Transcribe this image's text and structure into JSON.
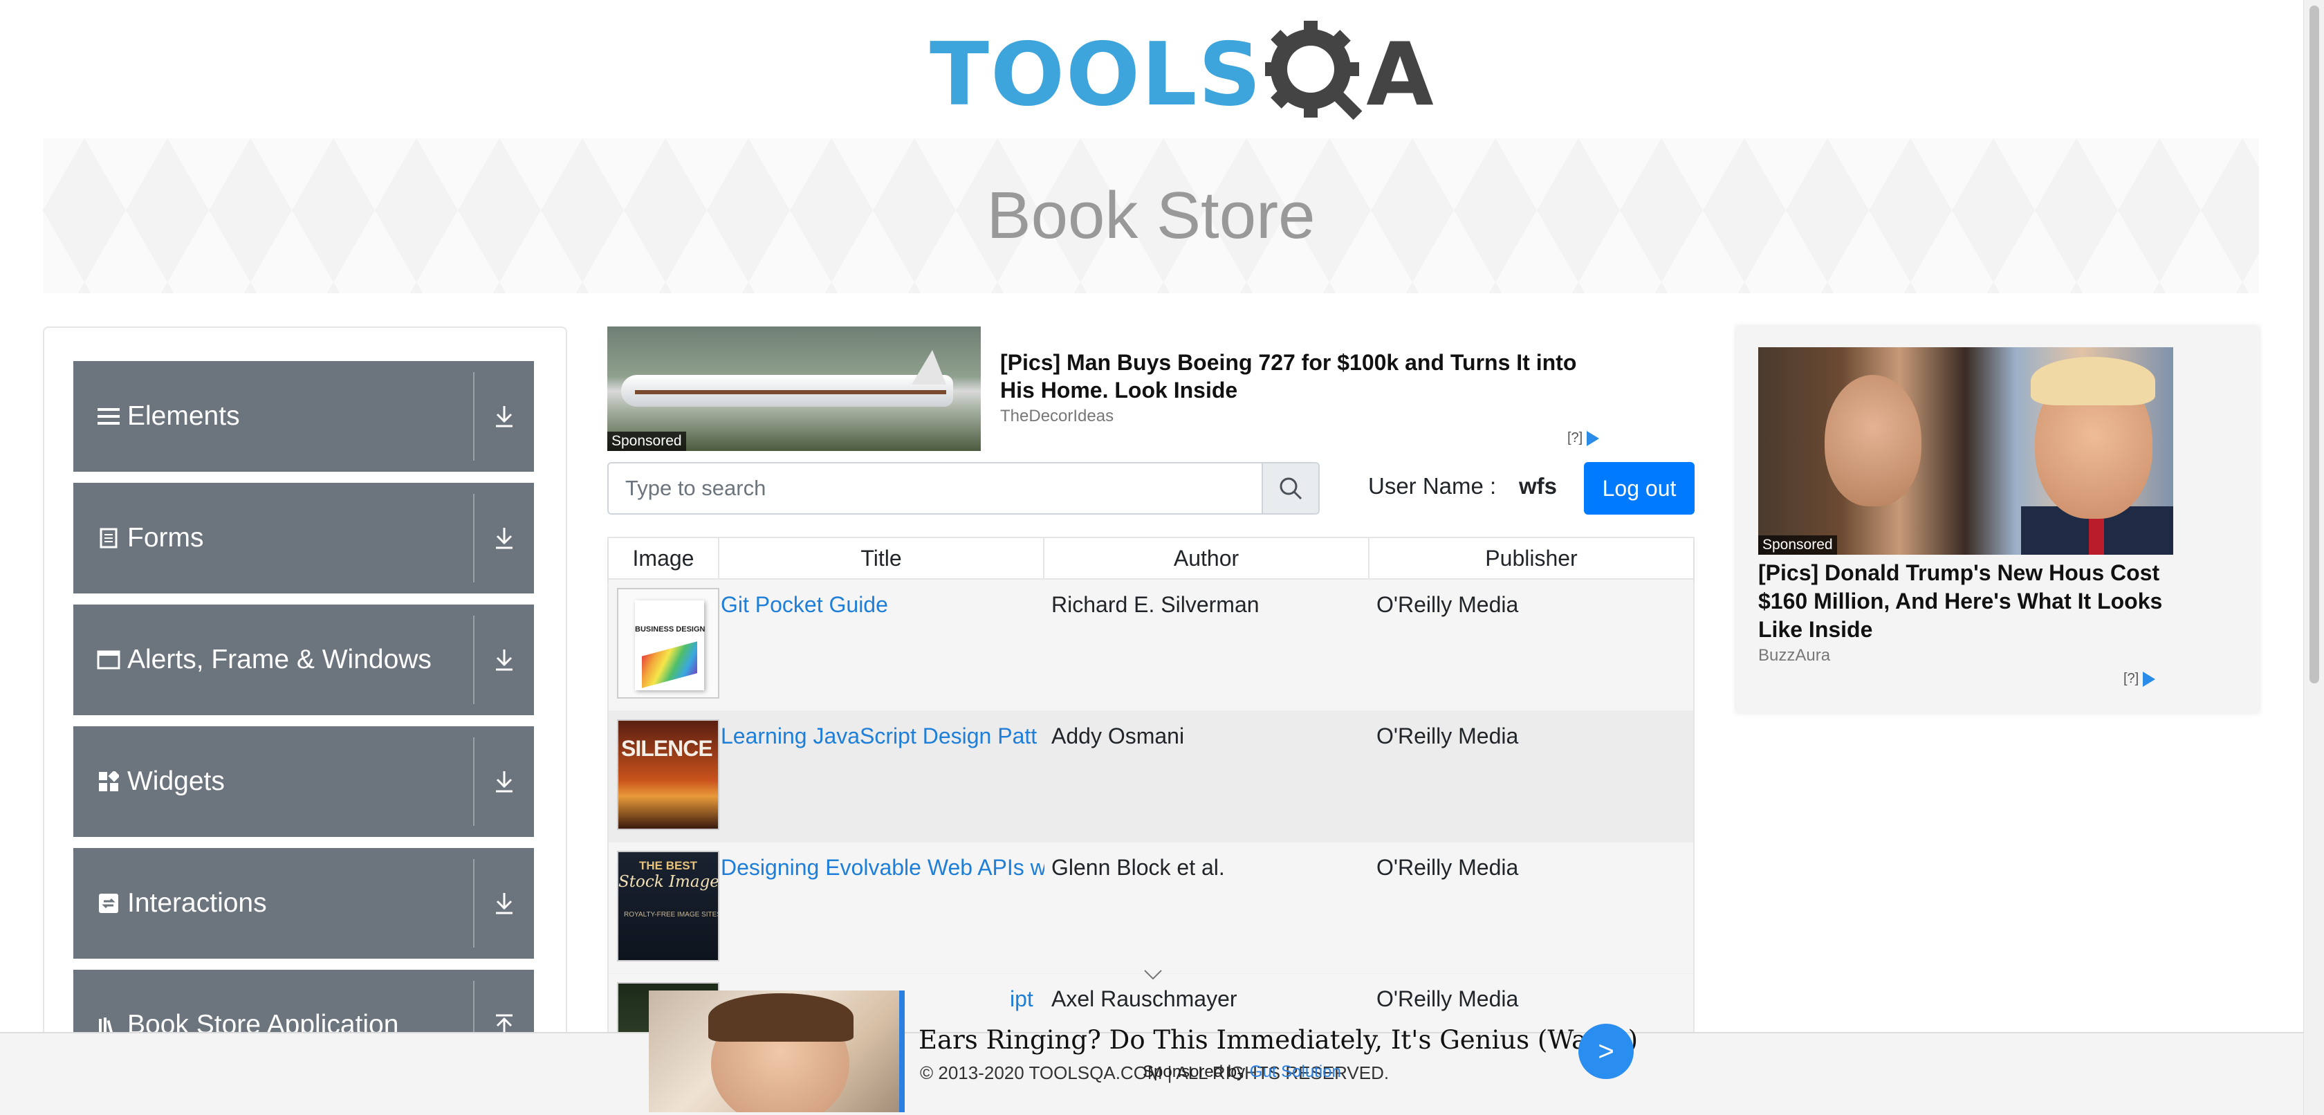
{
  "header": {
    "logo_left": "TOOLS",
    "logo_right": "A",
    "page_title": "Book Store"
  },
  "colors": {
    "brand_blue": "#3ea4dc",
    "nav_bg": "#6c757d",
    "primary": "#007bff",
    "link": "#1e7ed8"
  },
  "sidebar": {
    "groups": [
      {
        "label": "Elements",
        "icon": "hamburger-icon",
        "action_icon": "download-arrow-icon"
      },
      {
        "label": "Forms",
        "icon": "form-icon",
        "action_icon": "download-arrow-icon"
      },
      {
        "label": "Alerts, Frame & Windows",
        "icon": "window-icon",
        "action_icon": "download-arrow-icon"
      },
      {
        "label": "Widgets",
        "icon": "widgets-icon",
        "action_icon": "download-arrow-icon"
      },
      {
        "label": "Interactions",
        "icon": "interactions-icon",
        "action_icon": "download-arrow-icon"
      },
      {
        "label": "Book Store Application",
        "icon": "bookstore-icon",
        "action_icon": "upload-arrow-icon"
      }
    ]
  },
  "ad_top": {
    "tag": "Sponsored",
    "title": "[Pics] Man Buys Boeing 727 for $100k and Turns It into His Home. Look Inside",
    "source": "TheDecorIdeas",
    "choice": "[?]"
  },
  "search": {
    "placeholder": "Type to search",
    "icon": "search-icon"
  },
  "user": {
    "label": "User Name :",
    "name": "wfs",
    "logout": "Log out"
  },
  "table": {
    "columns": [
      "Image",
      "Title",
      "Author",
      "Publisher"
    ],
    "rows": [
      {
        "title": "Git Pocket Guide",
        "author": "Richard E. Silverman",
        "publisher": "O'Reilly Media",
        "cover_text": "BUSINESS DESIGN"
      },
      {
        "title": "Learning JavaScript Design Patt",
        "author": "Addy Osmani",
        "publisher": "O'Reilly Media",
        "cover_text": "SILENCE"
      },
      {
        "title": "Designing Evolvable Web APIs w",
        "author": "Glenn Block et al.",
        "publisher": "O'Reilly Media",
        "cover_text": "THE BEST",
        "cover_text2": "Stock Images",
        "cover_text3": "ROYALTY-FREE IMAGE SITES FOR BOOK COVERS"
      },
      {
        "title": "ipt",
        "author": "Axel Rauschmayer",
        "publisher": "O'Reilly Media"
      }
    ]
  },
  "ad_right": {
    "tag": "Sponsored",
    "title": "[Pics] Donald Trump's New Hous Cost $160 Million, And Here's What It Looks Like Inside",
    "source": "BuzzAura",
    "choice": "[?]"
  },
  "bottom_ad": {
    "title": "Ears Ringing? Do This Immediately, It's Genius (Watch)",
    "sponsored_prefix": "Sponsored by",
    "sponsor": "Gut Solution",
    "button": ">"
  },
  "footer": {
    "text": "© 2013-2020 TOOLSQA.COM | ALL RIGHTS RESERVED."
  }
}
